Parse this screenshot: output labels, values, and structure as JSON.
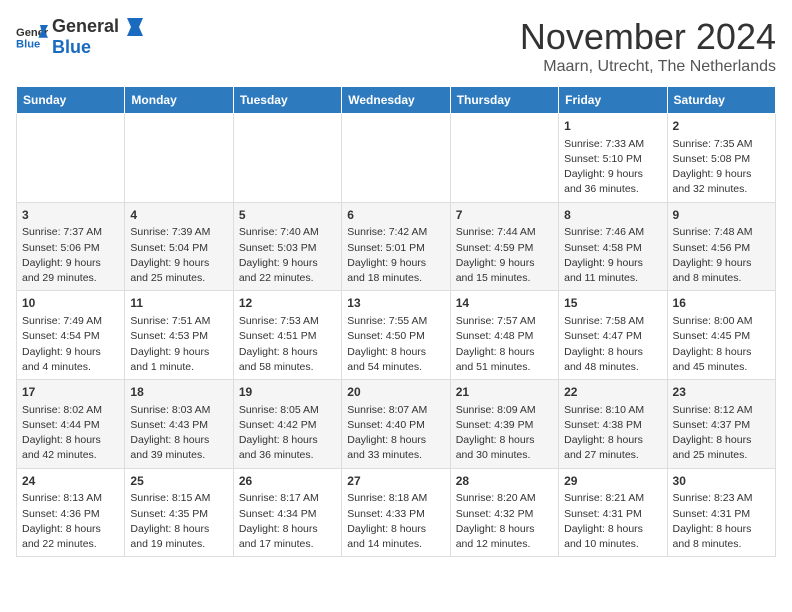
{
  "header": {
    "logo_general": "General",
    "logo_blue": "Blue",
    "month_title": "November 2024",
    "location": "Maarn, Utrecht, The Netherlands"
  },
  "columns": [
    "Sunday",
    "Monday",
    "Tuesday",
    "Wednesday",
    "Thursday",
    "Friday",
    "Saturday"
  ],
  "weeks": [
    [
      {
        "day": "",
        "info": ""
      },
      {
        "day": "",
        "info": ""
      },
      {
        "day": "",
        "info": ""
      },
      {
        "day": "",
        "info": ""
      },
      {
        "day": "",
        "info": ""
      },
      {
        "day": "1",
        "info": "Sunrise: 7:33 AM\nSunset: 5:10 PM\nDaylight: 9 hours and 36 minutes."
      },
      {
        "day": "2",
        "info": "Sunrise: 7:35 AM\nSunset: 5:08 PM\nDaylight: 9 hours and 32 minutes."
      }
    ],
    [
      {
        "day": "3",
        "info": "Sunrise: 7:37 AM\nSunset: 5:06 PM\nDaylight: 9 hours and 29 minutes."
      },
      {
        "day": "4",
        "info": "Sunrise: 7:39 AM\nSunset: 5:04 PM\nDaylight: 9 hours and 25 minutes."
      },
      {
        "day": "5",
        "info": "Sunrise: 7:40 AM\nSunset: 5:03 PM\nDaylight: 9 hours and 22 minutes."
      },
      {
        "day": "6",
        "info": "Sunrise: 7:42 AM\nSunset: 5:01 PM\nDaylight: 9 hours and 18 minutes."
      },
      {
        "day": "7",
        "info": "Sunrise: 7:44 AM\nSunset: 4:59 PM\nDaylight: 9 hours and 15 minutes."
      },
      {
        "day": "8",
        "info": "Sunrise: 7:46 AM\nSunset: 4:58 PM\nDaylight: 9 hours and 11 minutes."
      },
      {
        "day": "9",
        "info": "Sunrise: 7:48 AM\nSunset: 4:56 PM\nDaylight: 9 hours and 8 minutes."
      }
    ],
    [
      {
        "day": "10",
        "info": "Sunrise: 7:49 AM\nSunset: 4:54 PM\nDaylight: 9 hours and 4 minutes."
      },
      {
        "day": "11",
        "info": "Sunrise: 7:51 AM\nSunset: 4:53 PM\nDaylight: 9 hours and 1 minute."
      },
      {
        "day": "12",
        "info": "Sunrise: 7:53 AM\nSunset: 4:51 PM\nDaylight: 8 hours and 58 minutes."
      },
      {
        "day": "13",
        "info": "Sunrise: 7:55 AM\nSunset: 4:50 PM\nDaylight: 8 hours and 54 minutes."
      },
      {
        "day": "14",
        "info": "Sunrise: 7:57 AM\nSunset: 4:48 PM\nDaylight: 8 hours and 51 minutes."
      },
      {
        "day": "15",
        "info": "Sunrise: 7:58 AM\nSunset: 4:47 PM\nDaylight: 8 hours and 48 minutes."
      },
      {
        "day": "16",
        "info": "Sunrise: 8:00 AM\nSunset: 4:45 PM\nDaylight: 8 hours and 45 minutes."
      }
    ],
    [
      {
        "day": "17",
        "info": "Sunrise: 8:02 AM\nSunset: 4:44 PM\nDaylight: 8 hours and 42 minutes."
      },
      {
        "day": "18",
        "info": "Sunrise: 8:03 AM\nSunset: 4:43 PM\nDaylight: 8 hours and 39 minutes."
      },
      {
        "day": "19",
        "info": "Sunrise: 8:05 AM\nSunset: 4:42 PM\nDaylight: 8 hours and 36 minutes."
      },
      {
        "day": "20",
        "info": "Sunrise: 8:07 AM\nSunset: 4:40 PM\nDaylight: 8 hours and 33 minutes."
      },
      {
        "day": "21",
        "info": "Sunrise: 8:09 AM\nSunset: 4:39 PM\nDaylight: 8 hours and 30 minutes."
      },
      {
        "day": "22",
        "info": "Sunrise: 8:10 AM\nSunset: 4:38 PM\nDaylight: 8 hours and 27 minutes."
      },
      {
        "day": "23",
        "info": "Sunrise: 8:12 AM\nSunset: 4:37 PM\nDaylight: 8 hours and 25 minutes."
      }
    ],
    [
      {
        "day": "24",
        "info": "Sunrise: 8:13 AM\nSunset: 4:36 PM\nDaylight: 8 hours and 22 minutes."
      },
      {
        "day": "25",
        "info": "Sunrise: 8:15 AM\nSunset: 4:35 PM\nDaylight: 8 hours and 19 minutes."
      },
      {
        "day": "26",
        "info": "Sunrise: 8:17 AM\nSunset: 4:34 PM\nDaylight: 8 hours and 17 minutes."
      },
      {
        "day": "27",
        "info": "Sunrise: 8:18 AM\nSunset: 4:33 PM\nDaylight: 8 hours and 14 minutes."
      },
      {
        "day": "28",
        "info": "Sunrise: 8:20 AM\nSunset: 4:32 PM\nDaylight: 8 hours and 12 minutes."
      },
      {
        "day": "29",
        "info": "Sunrise: 8:21 AM\nSunset: 4:31 PM\nDaylight: 8 hours and 10 minutes."
      },
      {
        "day": "30",
        "info": "Sunrise: 8:23 AM\nSunset: 4:31 PM\nDaylight: 8 hours and 8 minutes."
      }
    ]
  ]
}
